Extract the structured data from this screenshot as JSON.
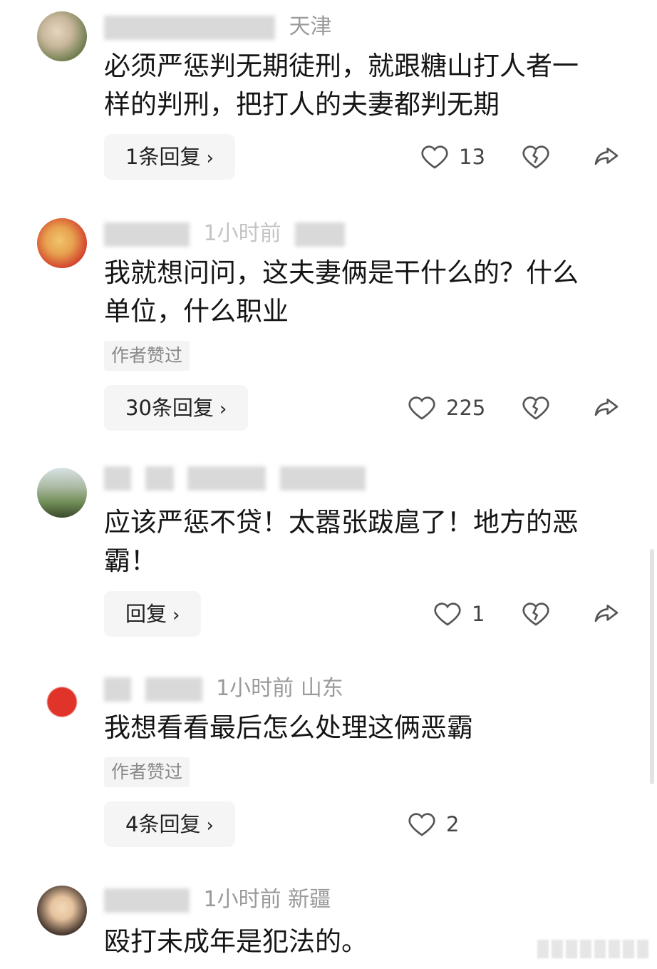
{
  "comments": [
    {
      "meta_visible": "天津",
      "text": "必须严惩判无期徒刑，就跟糖山打人者一样的判刑，把打人的夫妻都判无期",
      "badge": "",
      "reply_label": "1条回复",
      "likes": "13",
      "avatar_colors": [
        "#c9b79c",
        "#6a7a4a"
      ]
    },
    {
      "meta_visible": "1小时前",
      "text": "我就想问问，这夫妻俩是干什么的？什么单位，什么职业",
      "badge": "作者赞过",
      "reply_label": "30条回复",
      "likes": "225",
      "avatar_colors": [
        "#d13a2a",
        "#f2c46d"
      ]
    },
    {
      "meta_visible": "",
      "text": "应该严惩不贷！太嚣张跋扈了！地方的恶霸！",
      "badge": "",
      "reply_label": "回复",
      "likes": "1",
      "avatar_colors": [
        "#6f8c56",
        "#3a4a2c"
      ]
    },
    {
      "meta_visible": "1小时前  山东",
      "text": "我想看看最后怎么处理这俩恶霸",
      "badge": "作者赞过",
      "reply_label": "4条回复",
      "likes": "2",
      "avatar_colors": [
        "#ffffff",
        "#e0342a"
      ]
    },
    {
      "meta_visible": "1小时前  新疆",
      "text": "殴打未成年是犯法的。",
      "badge": "",
      "reply_label": "",
      "likes": "",
      "avatar_colors": [
        "#f3d9b8",
        "#4a3a30"
      ]
    }
  ],
  "icons": {
    "like": "heart-outline-icon",
    "dislike": "broken-heart-icon",
    "share": "share-arrow-icon",
    "chevron": "chevron-right-icon"
  }
}
